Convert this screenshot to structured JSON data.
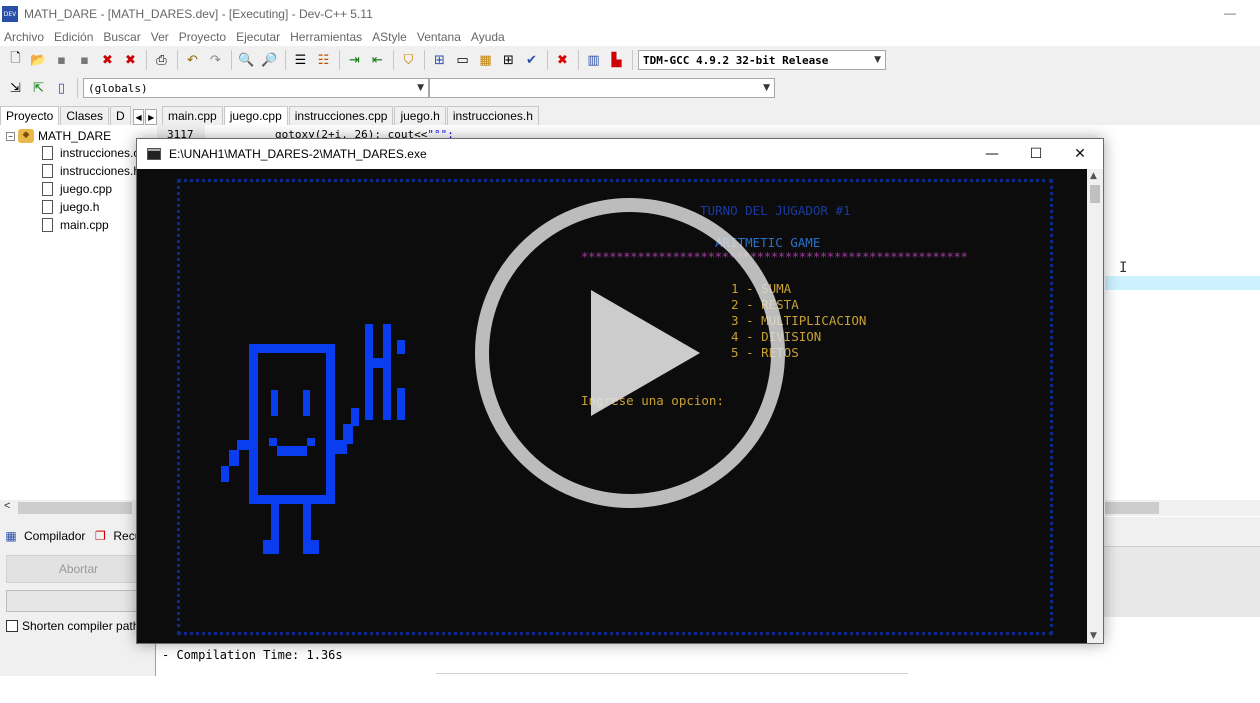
{
  "ide": {
    "title": "MATH_DARE - [MATH_DARES.dev] - [Executing] - Dev-C++ 5.11",
    "app_icon_label": "DEV",
    "menu": [
      "Archivo",
      "Edición",
      "Buscar",
      "Ver",
      "Proyecto",
      "Ejecutar",
      "Herramientas",
      "AStyle",
      "Ventana",
      "Ayuda"
    ],
    "compiler_select": "TDM-GCC 4.9.2 32-bit Release",
    "scope_select": "(globals)",
    "left_tabs": [
      "Proyecto",
      "Clases",
      "D"
    ],
    "project": {
      "root": "MATH_DARE",
      "files": [
        "instrucciones.cpp",
        "instrucciones.h",
        "juego.cpp",
        "juego.h",
        "main.cpp"
      ]
    },
    "editor_tabs": [
      "main.cpp",
      "juego.cpp",
      "instrucciones.cpp",
      "juego.h",
      "instrucciones.h"
    ],
    "active_editor_tab": "juego.cpp",
    "editor": {
      "line_number": "3117",
      "code_fn": "gotoxy(2+i, 26); cout<<",
      "code_str": "\"°\";"
    },
    "bottom_tabs": [
      "Compilador",
      "Recursos"
    ],
    "abort_label": "Abortar",
    "shorten_label": "Shorten compiler paths",
    "compile_time": "- Compilation Time: 1.36s"
  },
  "console": {
    "title": "E:\\UNAH1\\MATH_DARES-2\\MATH_DARES.exe",
    "turn": "TURNO DEL JUGADOR #1",
    "game_title": "ARITMETIC GAME",
    "divider": "*******************************************************",
    "options": [
      "1 - SUMA",
      "2 - RESTA",
      "3 - MULTIPLICACION",
      "4 - DIVISION",
      "5 - RETOS"
    ],
    "prompt": "Ingrese una opcion:",
    "robot_greeting": "Hi"
  },
  "colors": {
    "console_bg": "#0c0c0c",
    "robot_blue": "#0a3cf0",
    "menu_gold": "#c8a032",
    "title_blue": "#2a70c8",
    "divider_magenta": "#a03a9c",
    "editor_highlight": "#ccf2ff"
  },
  "icons": {
    "play": "play-icon"
  }
}
